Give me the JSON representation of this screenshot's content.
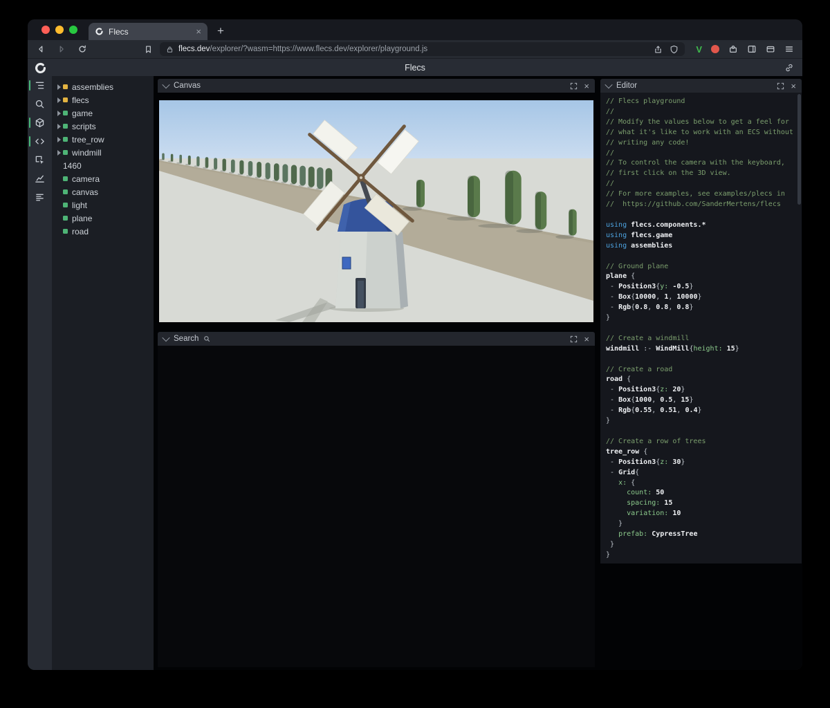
{
  "window": {
    "traffic_lights": [
      "#ff5f57",
      "#febc2e",
      "#28c840"
    ]
  },
  "browser": {
    "tab_title": "Flecs",
    "new_tab_glyph": "+",
    "close_glyph": "×",
    "url_host": "flecs.dev",
    "url_path": "/explorer/?wasm=https://www.flecs.dev/explorer/playground.js",
    "extension_v_label": "V",
    "accent_green": "#3fbb4d",
    "accent_red": "#e2574c"
  },
  "app": {
    "title": "Flecs"
  },
  "ui": {
    "close_glyph": "×"
  },
  "rail_icons": [
    {
      "icon": "outline-tree-icon",
      "active": true
    },
    {
      "icon": "search-icon",
      "active": false
    },
    {
      "icon": "entities-icon",
      "active": true
    },
    {
      "icon": "code-icon",
      "active": true
    },
    {
      "icon": "inspect-icon",
      "active": false
    },
    {
      "icon": "chart-icon",
      "active": false
    },
    {
      "icon": "stats-icon",
      "active": false
    }
  ],
  "tree": {
    "module_color": "#e3b341",
    "entity_color": "#4eb476",
    "items": [
      {
        "label": "assemblies",
        "kind": "module",
        "expandable": true
      },
      {
        "label": "flecs",
        "kind": "module",
        "expandable": true
      },
      {
        "label": "game",
        "kind": "entity",
        "expandable": true
      },
      {
        "label": "scripts",
        "kind": "entity",
        "expandable": true
      },
      {
        "label": "tree_row",
        "kind": "entity",
        "expandable": true
      },
      {
        "label": "windmill",
        "kind": "entity",
        "expandable": true
      },
      {
        "label": "1460",
        "kind": "none",
        "expandable": false
      },
      {
        "label": "camera",
        "kind": "entity",
        "expandable": false
      },
      {
        "label": "canvas",
        "kind": "entity",
        "expandable": false
      },
      {
        "label": "light",
        "kind": "entity",
        "expandable": false
      },
      {
        "label": "plane",
        "kind": "entity",
        "expandable": false
      },
      {
        "label": "road",
        "kind": "entity",
        "expandable": false
      }
    ]
  },
  "panels": {
    "canvas": {
      "title": "Canvas"
    },
    "search": {
      "title": "Search"
    },
    "editor": {
      "title": "Editor"
    }
  },
  "editor": {
    "lines": [
      [
        [
          "c",
          "// Flecs playground"
        ]
      ],
      [
        [
          "c",
          "//"
        ]
      ],
      [
        [
          "c",
          "// Modify the values below to get a feel for"
        ]
      ],
      [
        [
          "c",
          "// what it's like to work with an ECS without"
        ]
      ],
      [
        [
          "c",
          "// writing any code!"
        ]
      ],
      [
        [
          "c",
          "//"
        ]
      ],
      [
        [
          "c",
          "// To control the camera with the keyboard,"
        ]
      ],
      [
        [
          "c",
          "// first click on the 3D view."
        ]
      ],
      [
        [
          "c",
          "//"
        ]
      ],
      [
        [
          "c",
          "// For more examples, see examples/plecs in"
        ]
      ],
      [
        [
          "c",
          "//  https://github.com/SanderMertens/flecs"
        ]
      ],
      [],
      [
        [
          "k",
          "using "
        ],
        [
          "b",
          "flecs.components.*"
        ]
      ],
      [
        [
          "k",
          "using "
        ],
        [
          "b",
          "flecs.game"
        ]
      ],
      [
        [
          "k",
          "using "
        ],
        [
          "b",
          "assemblies"
        ]
      ],
      [],
      [
        [
          "c",
          "// Ground plane"
        ]
      ],
      [
        [
          "b",
          "plane "
        ],
        [
          "p",
          "{"
        ]
      ],
      [
        [
          "p",
          " - "
        ],
        [
          "b",
          "Position3"
        ],
        [
          "p",
          "{"
        ],
        [
          "g",
          "y: "
        ],
        [
          "b",
          "-0.5"
        ],
        [
          "p",
          "}"
        ]
      ],
      [
        [
          "p",
          " - "
        ],
        [
          "b",
          "Box"
        ],
        [
          "p",
          "{"
        ],
        [
          "b",
          "10000"
        ],
        [
          "p",
          ", "
        ],
        [
          "b",
          "1"
        ],
        [
          "p",
          ", "
        ],
        [
          "b",
          "10000"
        ],
        [
          "p",
          "}"
        ]
      ],
      [
        [
          "p",
          " - "
        ],
        [
          "b",
          "Rgb"
        ],
        [
          "p",
          "{"
        ],
        [
          "b",
          "0.8"
        ],
        [
          "p",
          ", "
        ],
        [
          "b",
          "0.8"
        ],
        [
          "p",
          ", "
        ],
        [
          "b",
          "0.8"
        ],
        [
          "p",
          "}"
        ]
      ],
      [
        [
          "p",
          "}"
        ]
      ],
      [],
      [
        [
          "c",
          "// Create a windmill"
        ]
      ],
      [
        [
          "b",
          "windmill"
        ],
        [
          "p",
          " :- "
        ],
        [
          "b",
          "WindMill"
        ],
        [
          "p",
          "{"
        ],
        [
          "g",
          "height: "
        ],
        [
          "b",
          "15"
        ],
        [
          "p",
          "}"
        ]
      ],
      [],
      [
        [
          "c",
          "// Create a road"
        ]
      ],
      [
        [
          "b",
          "road "
        ],
        [
          "p",
          "{"
        ]
      ],
      [
        [
          "p",
          " - "
        ],
        [
          "b",
          "Position3"
        ],
        [
          "p",
          "{"
        ],
        [
          "g",
          "z: "
        ],
        [
          "b",
          "20"
        ],
        [
          "p",
          "}"
        ]
      ],
      [
        [
          "p",
          " - "
        ],
        [
          "b",
          "Box"
        ],
        [
          "p",
          "{"
        ],
        [
          "b",
          "1000"
        ],
        [
          "p",
          ", "
        ],
        [
          "b",
          "0.5"
        ],
        [
          "p",
          ", "
        ],
        [
          "b",
          "15"
        ],
        [
          "p",
          "}"
        ]
      ],
      [
        [
          "p",
          " - "
        ],
        [
          "b",
          "Rgb"
        ],
        [
          "p",
          "{"
        ],
        [
          "b",
          "0.55"
        ],
        [
          "p",
          ", "
        ],
        [
          "b",
          "0.51"
        ],
        [
          "p",
          ", "
        ],
        [
          "b",
          "0.4"
        ],
        [
          "p",
          "}"
        ]
      ],
      [
        [
          "p",
          "}"
        ]
      ],
      [],
      [
        [
          "c",
          "// Create a row of trees"
        ]
      ],
      [
        [
          "b",
          "tree_row "
        ],
        [
          "p",
          "{"
        ]
      ],
      [
        [
          "p",
          " - "
        ],
        [
          "b",
          "Position3"
        ],
        [
          "p",
          "{"
        ],
        [
          "g",
          "z: "
        ],
        [
          "b",
          "30"
        ],
        [
          "p",
          "}"
        ]
      ],
      [
        [
          "p",
          " - "
        ],
        [
          "b",
          "Grid"
        ],
        [
          "p",
          "{"
        ]
      ],
      [
        [
          "p",
          "   "
        ],
        [
          "g",
          "x: "
        ],
        [
          "p",
          "{"
        ]
      ],
      [
        [
          "p",
          "     "
        ],
        [
          "g",
          "count: "
        ],
        [
          "b",
          "50"
        ]
      ],
      [
        [
          "p",
          "     "
        ],
        [
          "g",
          "spacing: "
        ],
        [
          "b",
          "15"
        ]
      ],
      [
        [
          "p",
          "     "
        ],
        [
          "g",
          "variation: "
        ],
        [
          "b",
          "10"
        ]
      ],
      [
        [
          "p",
          "   }"
        ]
      ],
      [
        [
          "p",
          "   "
        ],
        [
          "g",
          "prefab: "
        ],
        [
          "b",
          "CypressTree"
        ]
      ],
      [
        [
          "p",
          " }"
        ]
      ],
      [
        [
          "p",
          "}"
        ]
      ]
    ]
  }
}
